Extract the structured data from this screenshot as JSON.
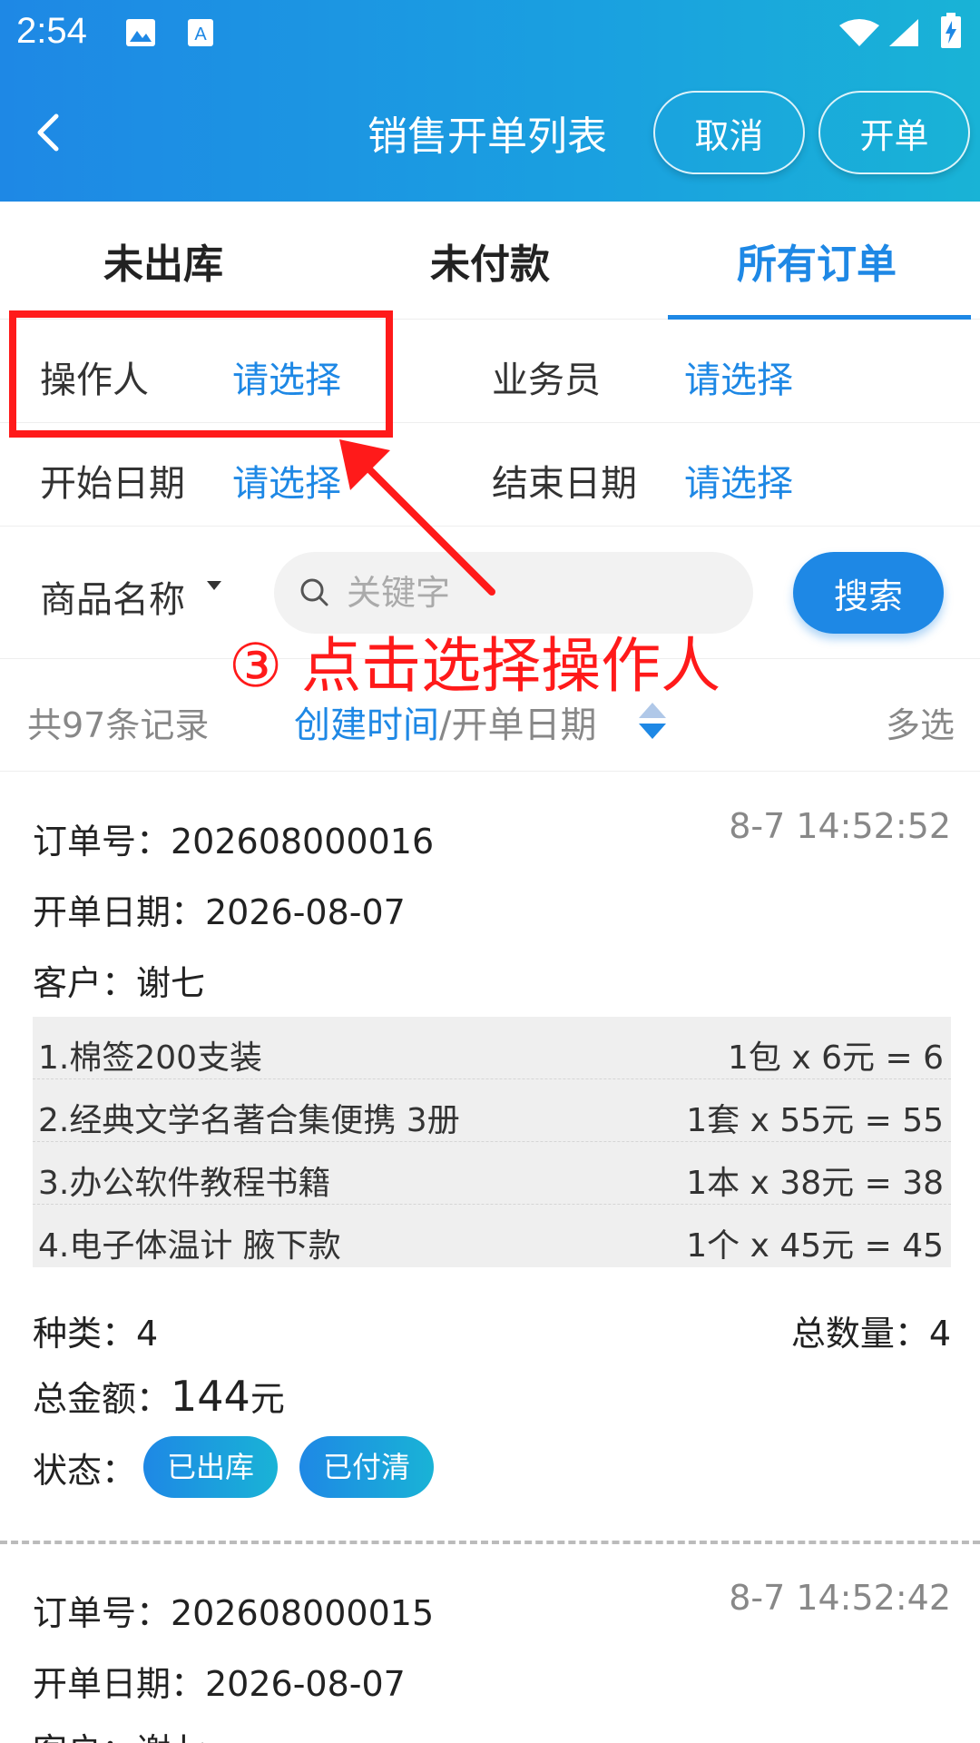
{
  "status_bar": {
    "time": "2:54"
  },
  "header": {
    "title": "销售开单列表",
    "cancel_label": "取消",
    "open_label": "开单"
  },
  "tabs": [
    {
      "label": "未出库",
      "active": false
    },
    {
      "label": "未付款",
      "active": false
    },
    {
      "label": "所有订单",
      "active": true
    }
  ],
  "filters": {
    "operator_label": "操作人",
    "operator_value": "请选择",
    "salesman_label": "业务员",
    "salesman_value": "请选择",
    "start_label": "开始日期",
    "start_value": "请选择",
    "end_label": "结束日期",
    "end_value": "请选择"
  },
  "search": {
    "field_label": "商品名称",
    "placeholder": "关键字",
    "button_label": "搜索"
  },
  "annotation": "③ 点击选择操作人",
  "records": {
    "count": "共97条记录",
    "sort_active": "创建时间",
    "sort_sep": "/开单日期",
    "multi_select": "多选"
  },
  "orders": [
    {
      "order_no": "订单号：202608000016",
      "timestamp": "8-7 14:52:52",
      "open_date": "开单日期：2026-08-07",
      "customer": "客户：谢七",
      "items": [
        {
          "name": "1.棉签200支装",
          "price": "1包 x 6元 = 6"
        },
        {
          "name": "2.经典文学名著合集便携 3册",
          "price": "1套 x 55元 = 55"
        },
        {
          "name": "3.办公软件教程书籍",
          "price": "1本 x 38元 = 38"
        },
        {
          "name": "4.电子体温计 腋下款",
          "price": "1个 x 45元 = 45"
        }
      ],
      "kinds": "种类：4",
      "total_qty": "总数量：4",
      "amount_label": "总金额：",
      "amount_value": "144",
      "amount_unit": "元",
      "status_label": "状态：",
      "status_badges": [
        "已出库",
        "已付清"
      ]
    },
    {
      "order_no": "订单号：202608000015",
      "timestamp": "8-7 14:52:42",
      "open_date": "开单日期：2026-08-07",
      "customer": "客户：谢七"
    }
  ]
}
